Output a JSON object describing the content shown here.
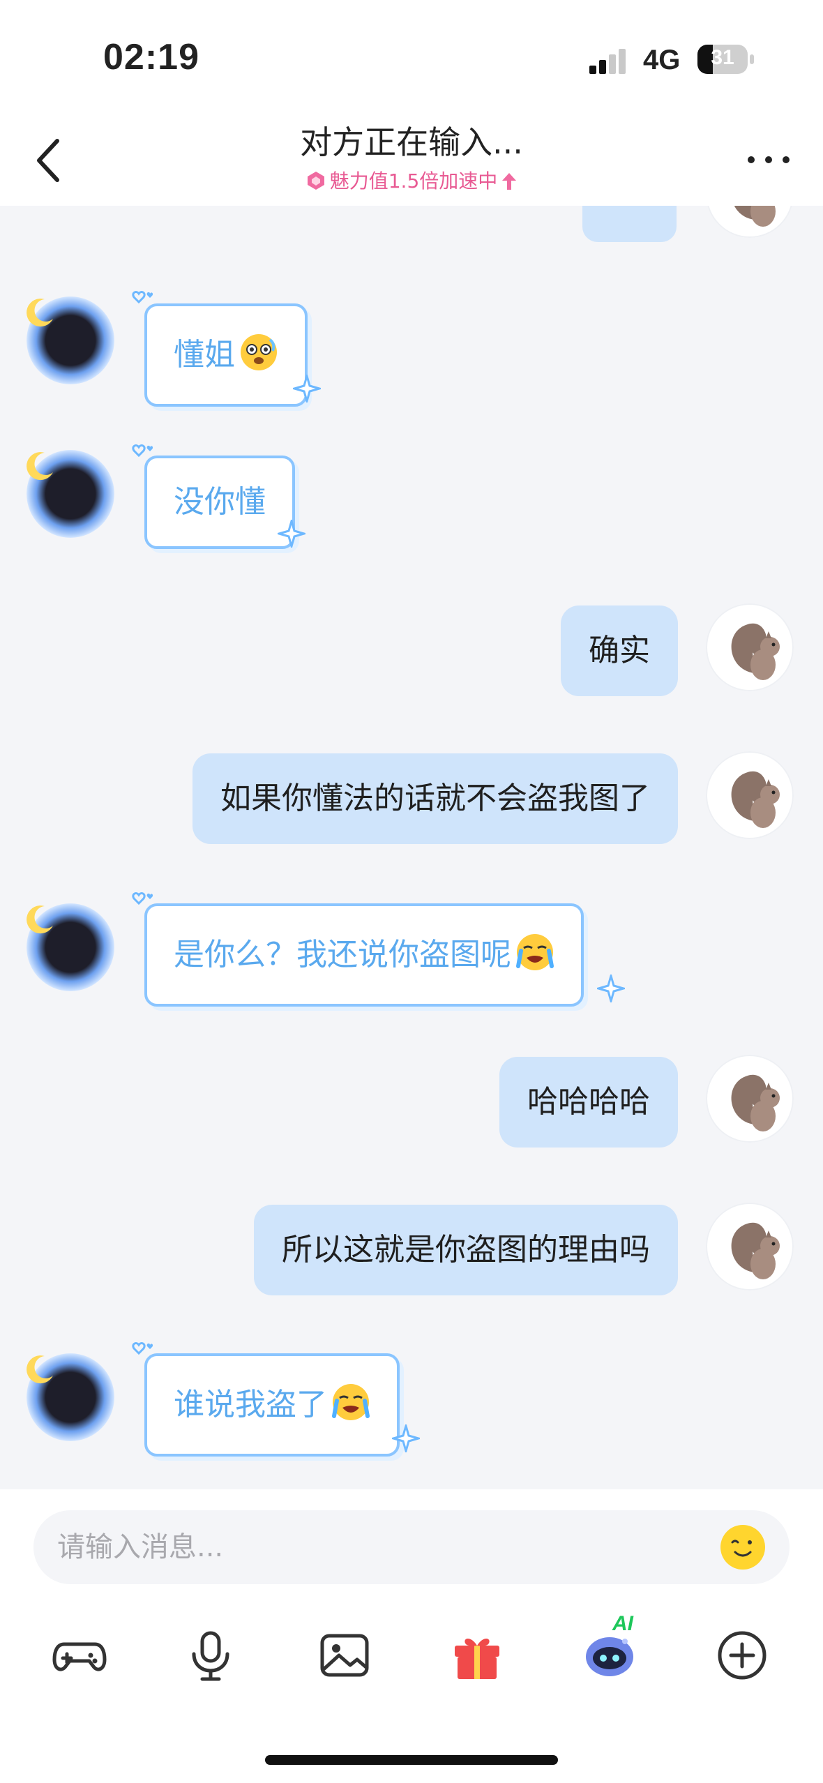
{
  "status_bar": {
    "time": "02:19",
    "network": "4G",
    "battery_level": "31"
  },
  "header": {
    "title": "对方正在输入...",
    "subtitle": "魅力值1.5倍加速中"
  },
  "messages": [
    {
      "side": "in",
      "text": "懂姐",
      "emoji": "dizzy-face-emoji"
    },
    {
      "side": "in",
      "text": "没你懂"
    },
    {
      "side": "out",
      "text": "确实"
    },
    {
      "side": "out",
      "text": "如果你懂法的话就不会盗我图了"
    },
    {
      "side": "in",
      "text": "是你么？我还说你盗图呢",
      "emoji": "crying-face-emoji"
    },
    {
      "side": "out",
      "text": "哈哈哈哈"
    },
    {
      "side": "out",
      "text": "所以这就是你盗图的理由吗"
    },
    {
      "side": "in",
      "text": "谁说我盗了",
      "emoji": "crying-face-emoji"
    }
  ],
  "input": {
    "placeholder": "请输入消息..."
  },
  "toolbar": {
    "items": [
      "game-controller-icon",
      "microphone-icon",
      "image-icon",
      "gift-icon",
      "ai-robot-icon",
      "plus-circle-icon"
    ],
    "ai_badge": "AI"
  },
  "colors": {
    "outgoing_bubble": "#cfe4fb",
    "incoming_border": "#8ac5ff",
    "incoming_text": "#5aa9ee",
    "accent_pink": "#e85a93",
    "gift_red": "#f04a4a"
  }
}
